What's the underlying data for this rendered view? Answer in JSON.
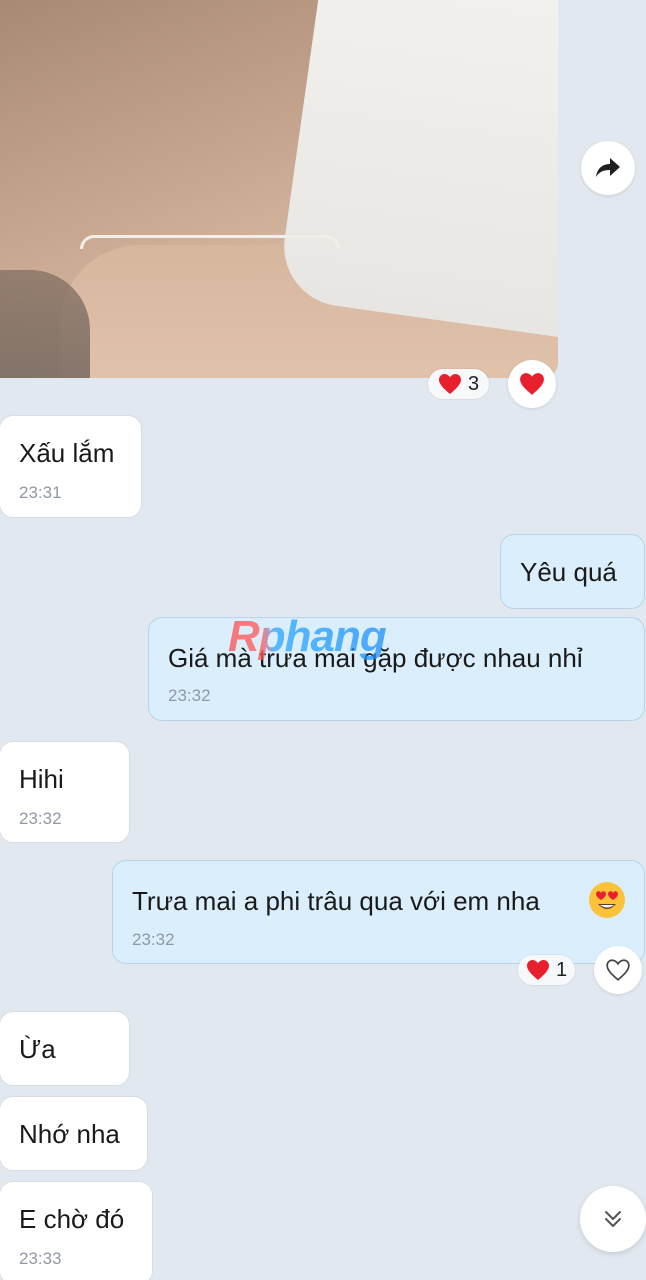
{
  "image_message": {
    "reaction_count": "3"
  },
  "messages": [
    {
      "direction": "in",
      "text": "Xấu lắm",
      "time": "23:31"
    },
    {
      "direction": "out",
      "text": "Yêu quá"
    },
    {
      "direction": "out",
      "text": "Giá mà trưa mai gặp được nhau nhỉ",
      "time": "23:32"
    },
    {
      "direction": "in",
      "text": "Hihi",
      "time": "23:32"
    },
    {
      "direction": "out",
      "text": "Trưa mai a phi trâu qua với em nha",
      "time": "23:32",
      "reaction_count": "1"
    },
    {
      "direction": "in",
      "text": "Ừa"
    },
    {
      "direction": "in",
      "text": "Nhớ nha"
    },
    {
      "direction": "in",
      "text": "E chờ đó",
      "time": "23:33"
    }
  ],
  "watermark": "Rphang",
  "colors": {
    "background": "#e2e8f0",
    "incoming_bubble": "#ffffff",
    "outgoing_bubble": "#dbeefc",
    "heart": "#e8202e",
    "timestamp": "#9099a3"
  },
  "icons": [
    "forward-icon",
    "heart-icon",
    "heart-outline-icon",
    "smiling-face-heart-eyes-emoji",
    "chevron-double-down-icon"
  ]
}
